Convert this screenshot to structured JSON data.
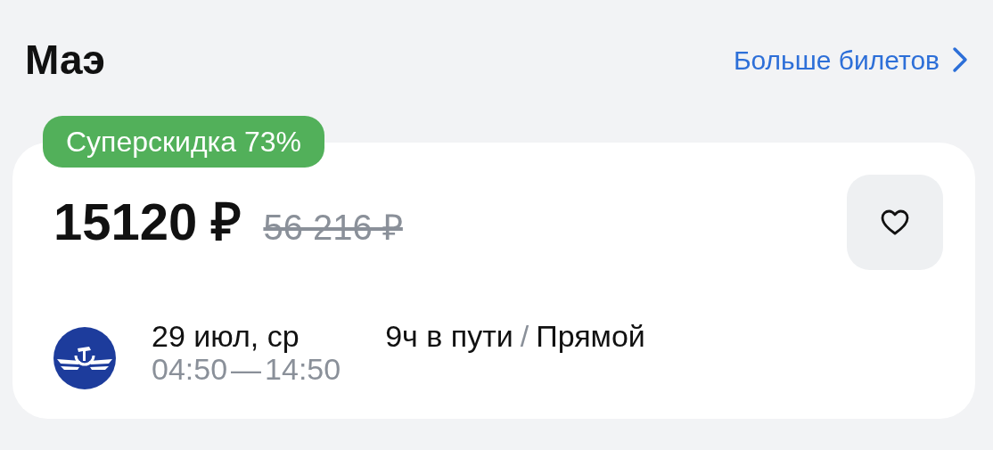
{
  "section": {
    "title": "Маэ",
    "more_link": "Больше билетов"
  },
  "ticket": {
    "discount_badge": "Суперскидка 73%",
    "price": "15120 ₽",
    "old_price": "56 216 ₽",
    "favorite": false,
    "flight": {
      "date": "29 июл, ср",
      "departure": "04:50",
      "time_separator": "—",
      "arrival": "14:50",
      "duration": "9ч в пути",
      "separator": "/",
      "stops": "Прямой"
    }
  }
}
